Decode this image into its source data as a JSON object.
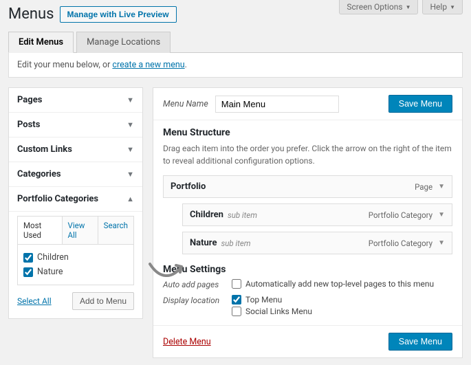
{
  "topright": {
    "screen_options": "Screen Options",
    "help": "Help"
  },
  "header": {
    "title": "Menus",
    "live_preview": "Manage with Live Preview"
  },
  "tabs": {
    "edit": "Edit Menus",
    "locations": "Manage Locations"
  },
  "notice": {
    "prefix": "Edit your menu below, or ",
    "link": "create a new menu",
    "suffix": "."
  },
  "accordion": {
    "pages": "Pages",
    "posts": "Posts",
    "custom_links": "Custom Links",
    "categories": "Categories",
    "portfolio_categories": "Portfolio Categories"
  },
  "subtabs": {
    "most_used": "Most Used",
    "view_all": "View All",
    "search": "Search"
  },
  "items": {
    "children": "Children",
    "nature": "Nature"
  },
  "actions": {
    "select_all": "Select All",
    "add_to_menu": "Add to Menu"
  },
  "menu": {
    "name_label": "Menu Name",
    "name_value": "Main Menu",
    "save": "Save Menu",
    "structure_title": "Menu Structure",
    "structure_desc": "Drag each item into the order you prefer. Click the arrow on the right of the item to reveal additional configuration options.",
    "items": [
      {
        "title": "Portfolio",
        "sub": "",
        "type": "Page",
        "indent": false
      },
      {
        "title": "Children",
        "sub": "sub item",
        "type": "Portfolio Category",
        "indent": true
      },
      {
        "title": "Nature",
        "sub": "sub item",
        "type": "Portfolio Category",
        "indent": true
      }
    ],
    "settings_title": "Menu Settings",
    "auto_add_label": "Auto add pages",
    "auto_add_text": "Automatically add new top-level pages to this menu",
    "display_location_label": "Display location",
    "loc_top": "Top Menu",
    "loc_social": "Social Links Menu",
    "delete": "Delete Menu"
  }
}
